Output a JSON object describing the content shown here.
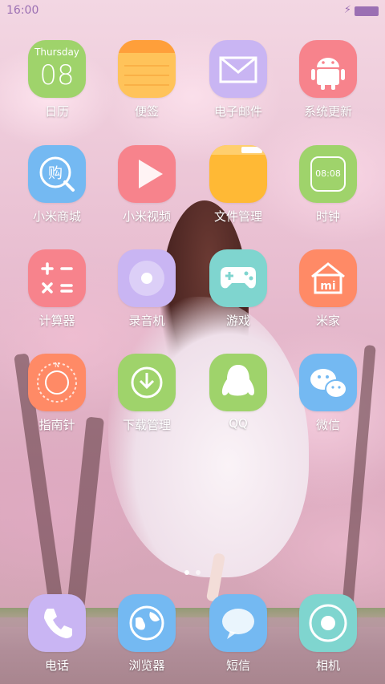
{
  "status_bar": {
    "time": "16:00",
    "charging_icon": "bolt-icon",
    "battery_icon": "battery-icon"
  },
  "calendar": {
    "day_name": "Thursday",
    "day_number": "08"
  },
  "clock_widget_time": "08:08",
  "rows": [
    [
      {
        "name": "calendar",
        "label": "日历",
        "icon": "calendar-icon",
        "color": "#9fd36b"
      },
      {
        "name": "notes",
        "label": "便签",
        "icon": "notes-icon",
        "color": "#ffc35a"
      },
      {
        "name": "email",
        "label": "电子邮件",
        "icon": "envelope-icon",
        "color": "#c9b5f3"
      },
      {
        "name": "system-update",
        "label": "系统更新",
        "icon": "android-icon",
        "color": "#f7838c"
      }
    ],
    [
      {
        "name": "mi-store",
        "label": "小米商城",
        "icon": "shopping-icon",
        "color": "#74b9f2"
      },
      {
        "name": "mi-video",
        "label": "小米视频",
        "icon": "play-icon",
        "color": "#f7838c"
      },
      {
        "name": "file-manager",
        "label": "文件管理",
        "icon": "folder-icon",
        "color": "#ffb935"
      },
      {
        "name": "clock",
        "label": "时钟",
        "icon": "clock-icon",
        "color": "#9fd36b"
      }
    ],
    [
      {
        "name": "calculator",
        "label": "计算器",
        "icon": "calculator-icon",
        "color": "#f7838c"
      },
      {
        "name": "recorder",
        "label": "录音机",
        "icon": "record-icon",
        "color": "#c9b5f3"
      },
      {
        "name": "games",
        "label": "游戏",
        "icon": "gamepad-icon",
        "color": "#7fd5cf"
      },
      {
        "name": "mi-home",
        "label": "米家",
        "icon": "home-icon",
        "color": "#ff8a66"
      }
    ],
    [
      {
        "name": "compass",
        "label": "指南针",
        "icon": "compass-icon",
        "color": "#ff8a66"
      },
      {
        "name": "downloads",
        "label": "下载管理",
        "icon": "download-icon",
        "color": "#9fd36b"
      },
      {
        "name": "qq",
        "label": "QQ",
        "icon": "penguin-icon",
        "color": "#9fd36b"
      },
      {
        "name": "wechat",
        "label": "微信",
        "icon": "chat-bubbles-icon",
        "color": "#74b9f2"
      }
    ]
  ],
  "dock": [
    {
      "name": "phone",
      "label": "电话",
      "icon": "phone-icon",
      "color": "#c9b5f3"
    },
    {
      "name": "browser",
      "label": "浏览器",
      "icon": "globe-icon",
      "color": "#74b9f2"
    },
    {
      "name": "messages",
      "label": "短信",
      "icon": "message-icon",
      "color": "#74b9f2"
    },
    {
      "name": "camera",
      "label": "相机",
      "icon": "camera-icon",
      "color": "#7fd5cf"
    }
  ],
  "page_indicator": {
    "pages": 2,
    "active": 0
  }
}
